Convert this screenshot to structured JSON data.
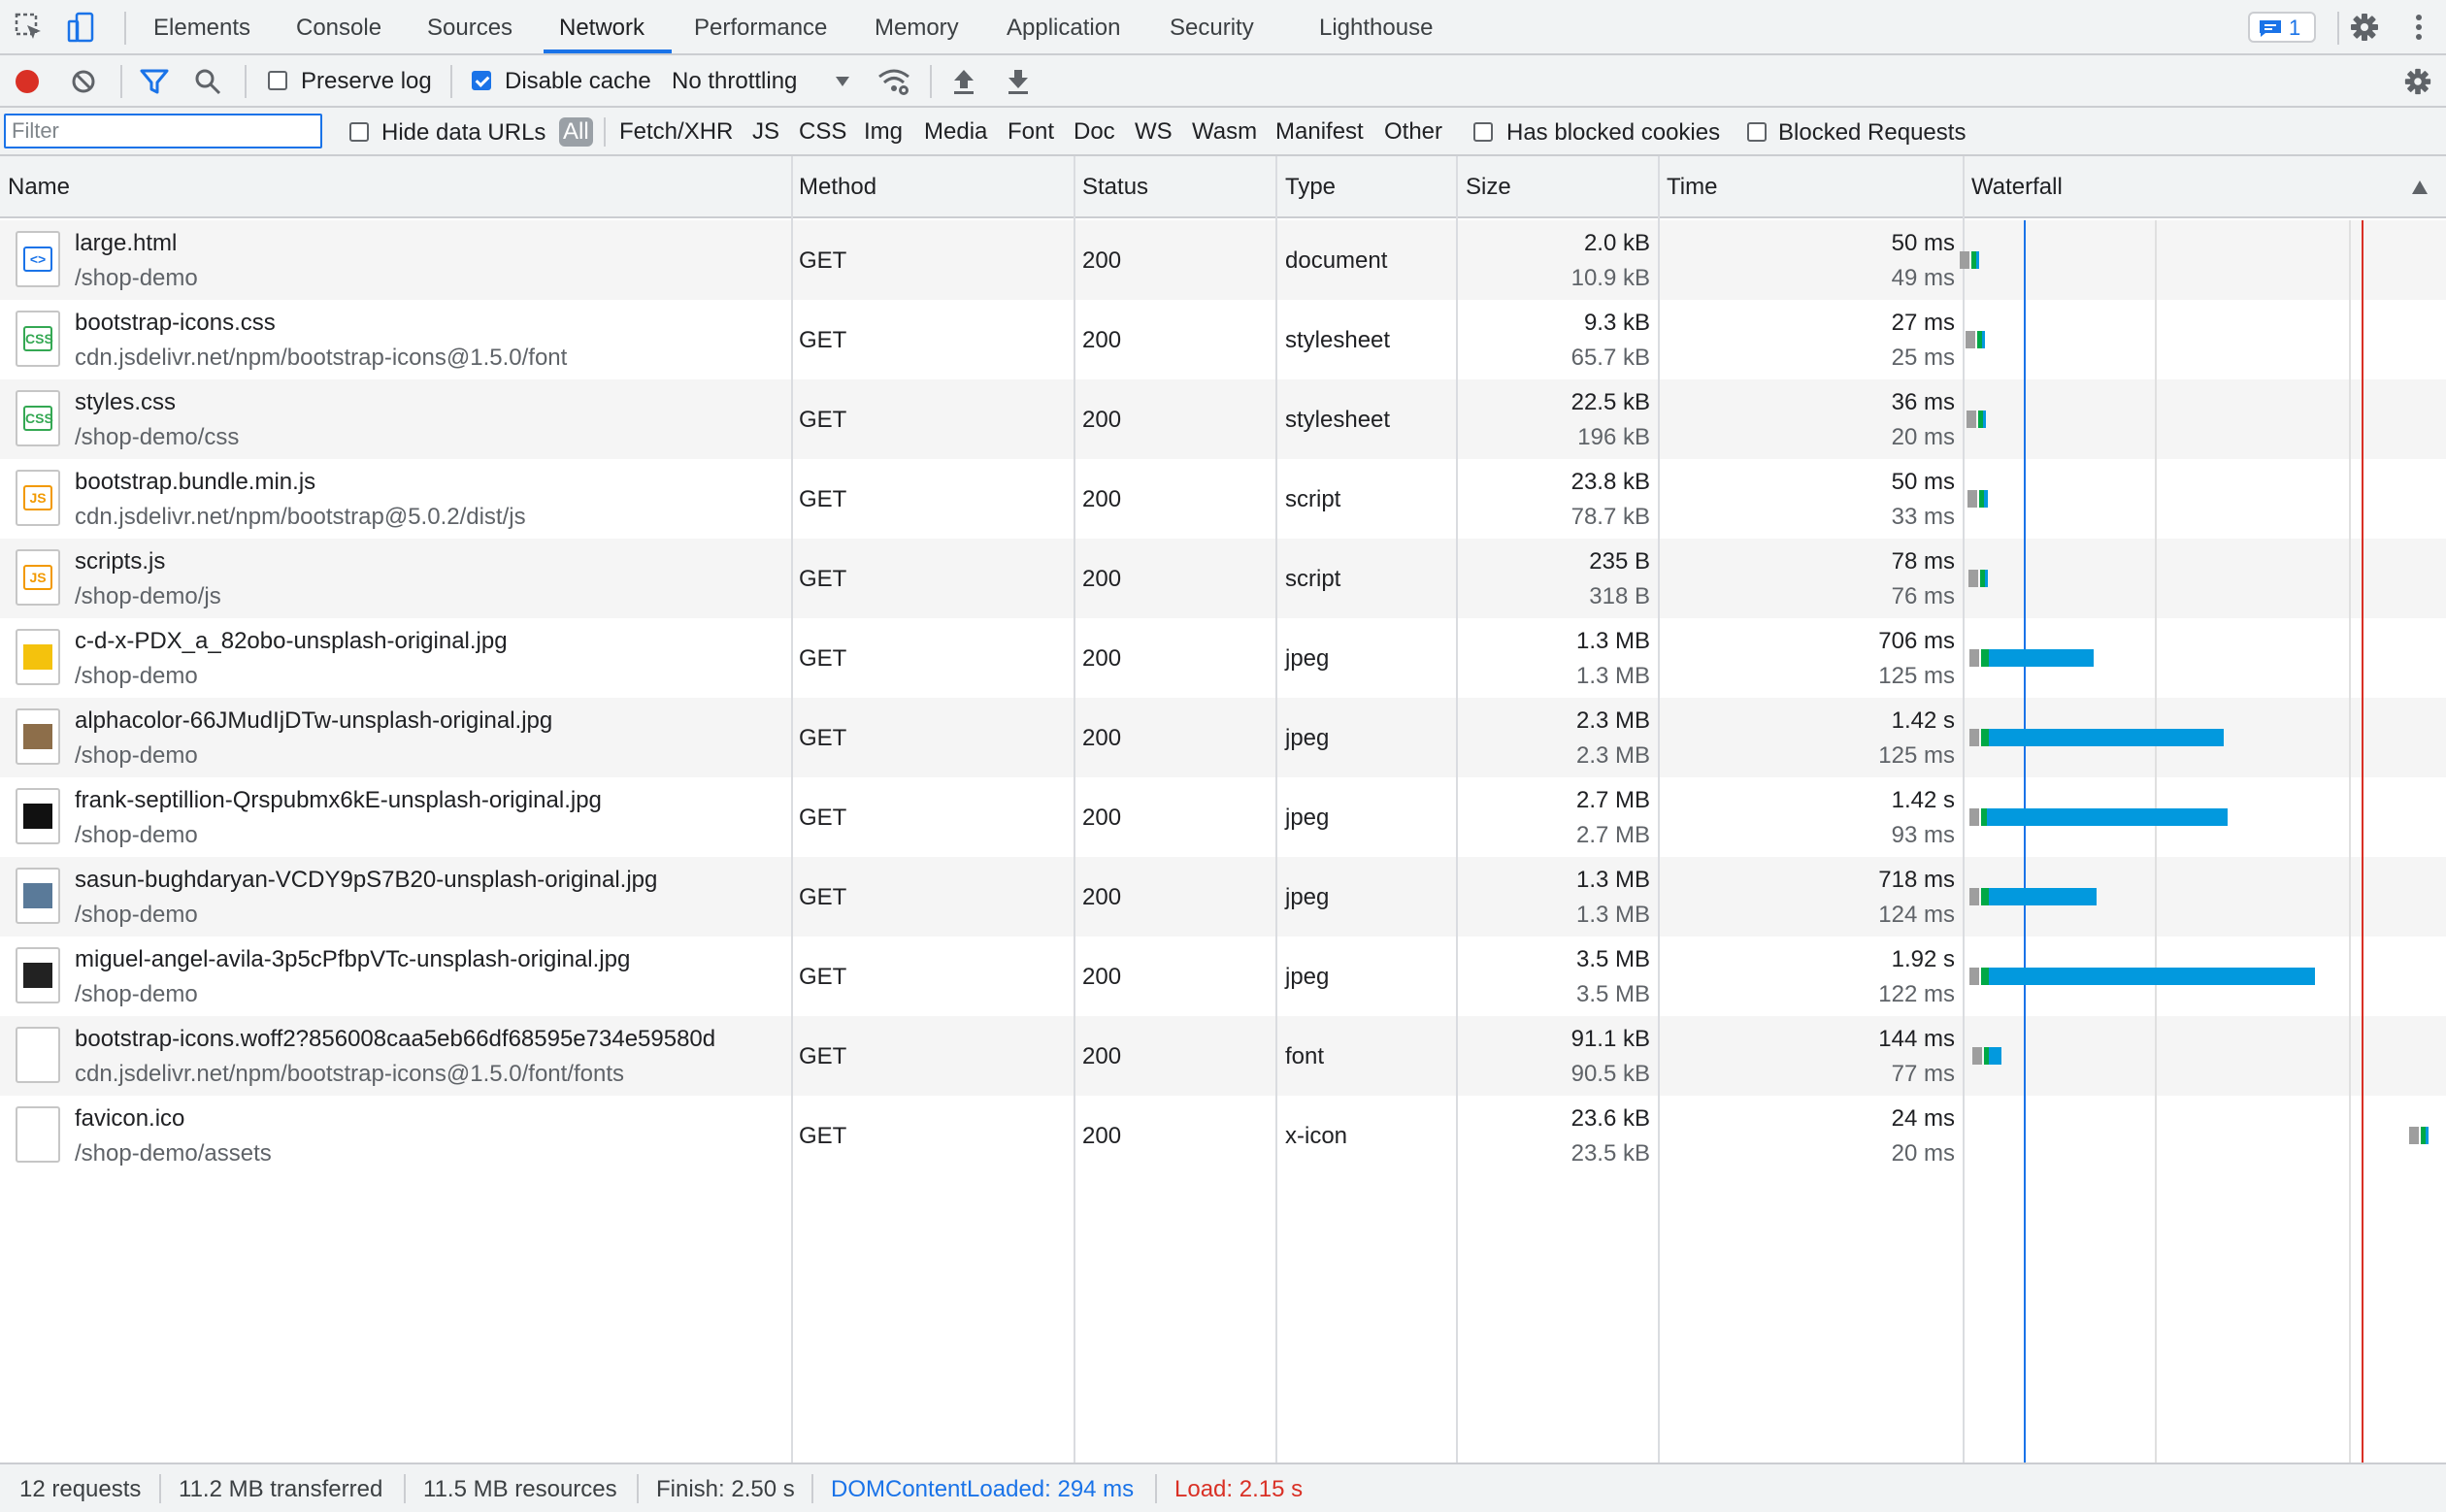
{
  "tabs": [
    "Elements",
    "Console",
    "Sources",
    "Network",
    "Performance",
    "Memory",
    "Application",
    "Security",
    "Lighthouse"
  ],
  "active_tab": "Network",
  "issues_count": "1",
  "toolbar": {
    "preserve_log": "Preserve log",
    "preserve_log_checked": false,
    "disable_cache": "Disable cache",
    "disable_cache_checked": true,
    "throttling": "No throttling"
  },
  "filter": {
    "placeholder": "Filter",
    "hide_data_urls": "Hide data URLs",
    "types": [
      "All",
      "Fetch/XHR",
      "JS",
      "CSS",
      "Img",
      "Media",
      "Font",
      "Doc",
      "WS",
      "Wasm",
      "Manifest",
      "Other"
    ],
    "selected_type": "All",
    "has_blocked_cookies": "Has blocked cookies",
    "blocked_requests": "Blocked Requests"
  },
  "columns": [
    "Name",
    "Method",
    "Status",
    "Type",
    "Size",
    "Time",
    "Waterfall"
  ],
  "requests": [
    {
      "name": "large.html",
      "path": "/shop-demo",
      "method": "GET",
      "status": "200",
      "type": "document",
      "size": "2.0 kB",
      "resource": "10.9 kB",
      "time": "50 ms",
      "latency": "49 ms",
      "icon": "html-file-icon"
    },
    {
      "name": "bootstrap-icons.css",
      "path": "cdn.jsdelivr.net/npm/bootstrap-icons@1.5.0/font",
      "method": "GET",
      "status": "200",
      "type": "stylesheet",
      "size": "9.3 kB",
      "resource": "65.7 kB",
      "time": "27 ms",
      "latency": "25 ms",
      "icon": "css-file-icon"
    },
    {
      "name": "styles.css",
      "path": "/shop-demo/css",
      "method": "GET",
      "status": "200",
      "type": "stylesheet",
      "size": "22.5 kB",
      "resource": "196 kB",
      "time": "36 ms",
      "latency": "20 ms",
      "icon": "css-file-icon"
    },
    {
      "name": "bootstrap.bundle.min.js",
      "path": "cdn.jsdelivr.net/npm/bootstrap@5.0.2/dist/js",
      "method": "GET",
      "status": "200",
      "type": "script",
      "size": "23.8 kB",
      "resource": "78.7 kB",
      "time": "50 ms",
      "latency": "33 ms",
      "icon": "js-file-icon"
    },
    {
      "name": "scripts.js",
      "path": "/shop-demo/js",
      "method": "GET",
      "status": "200",
      "type": "script",
      "size": "235 B",
      "resource": "318 B",
      "time": "78 ms",
      "latency": "76 ms",
      "icon": "js-file-icon"
    },
    {
      "name": "c-d-x-PDX_a_82obo-unsplash-original.jpg",
      "path": "/shop-demo",
      "method": "GET",
      "status": "200",
      "type": "jpeg",
      "size": "1.3 MB",
      "resource": "1.3 MB",
      "time": "706 ms",
      "latency": "125 ms",
      "icon": "image-thumbnail-icon"
    },
    {
      "name": "alphacolor-66JMudIjDTw-unsplash-original.jpg",
      "path": "/shop-demo",
      "method": "GET",
      "status": "200",
      "type": "jpeg",
      "size": "2.3 MB",
      "resource": "2.3 MB",
      "time": "1.42 s",
      "latency": "125 ms",
      "icon": "image-thumbnail-icon"
    },
    {
      "name": "frank-septillion-Qrspubmx6kE-unsplash-original.jpg",
      "path": "/shop-demo",
      "method": "GET",
      "status": "200",
      "type": "jpeg",
      "size": "2.7 MB",
      "resource": "2.7 MB",
      "time": "1.42 s",
      "latency": "93 ms",
      "icon": "image-thumbnail-icon"
    },
    {
      "name": "sasun-bughdaryan-VCDY9pS7B20-unsplash-original.jpg",
      "path": "/shop-demo",
      "method": "GET",
      "status": "200",
      "type": "jpeg",
      "size": "1.3 MB",
      "resource": "1.3 MB",
      "time": "718 ms",
      "latency": "124 ms",
      "icon": "image-thumbnail-icon"
    },
    {
      "name": "miguel-angel-avila-3p5cPfbpVTc-unsplash-original.jpg",
      "path": "/shop-demo",
      "method": "GET",
      "status": "200",
      "type": "jpeg",
      "size": "3.5 MB",
      "resource": "3.5 MB",
      "time": "1.92 s",
      "latency": "122 ms",
      "icon": "image-thumbnail-icon"
    },
    {
      "name": "bootstrap-icons.woff2?856008caa5eb66df68595e734e59580d",
      "path": "cdn.jsdelivr.net/npm/bootstrap-icons@1.5.0/font/fonts",
      "method": "GET",
      "status": "200",
      "type": "font",
      "size": "91.1 kB",
      "resource": "90.5 kB",
      "time": "144 ms",
      "latency": "77 ms",
      "icon": "blank-file-icon"
    },
    {
      "name": "favicon.ico",
      "path": "/shop-demo/assets",
      "method": "GET",
      "status": "200",
      "type": "x-icon",
      "size": "23.6 kB",
      "resource": "23.5 kB",
      "time": "24 ms",
      "latency": "20 ms",
      "icon": "blank-file-icon"
    }
  ],
  "status_bar": {
    "requests": "12 requests",
    "transferred": "11.2 MB transferred",
    "resources": "11.5 MB resources",
    "finish": "Finish: 2.50 s",
    "dom_content_loaded": "DOMContentLoaded: 294 ms",
    "load": "Load: 2.15 s"
  },
  "colors": {
    "accent": "#1a73e8",
    "waiting": "#00a846",
    "download": "#0299de",
    "queue": "#9e9e9e",
    "dcl_line": "#1a73e8",
    "load_line": "#d93025",
    "record": "#d93025"
  }
}
